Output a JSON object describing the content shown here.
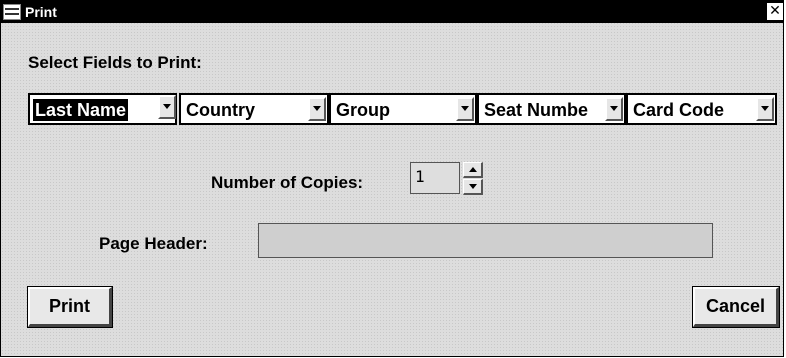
{
  "window": {
    "title": "Print",
    "close_glyph": "✕"
  },
  "dialog": {
    "fields_label": "Select Fields to Print:",
    "fields": [
      {
        "value": "Last Name",
        "selected": true
      },
      {
        "value": "Country",
        "selected": false
      },
      {
        "value": "Group",
        "selected": false
      },
      {
        "value": "Seat Numbe",
        "selected": false
      },
      {
        "value": "Card Code",
        "selected": false
      }
    ],
    "copies_label": "Number of Copies:",
    "copies_value": "1",
    "page_header_label": "Page Header:",
    "page_header_value": "",
    "print_label": "Print",
    "cancel_label": "Cancel"
  },
  "icons": {
    "system_menu": "system-menu-icon",
    "close": "close-icon",
    "dropdown": "dropdown-arrow-icon",
    "spin_up": "spin-up-icon",
    "spin_down": "spin-down-icon"
  }
}
